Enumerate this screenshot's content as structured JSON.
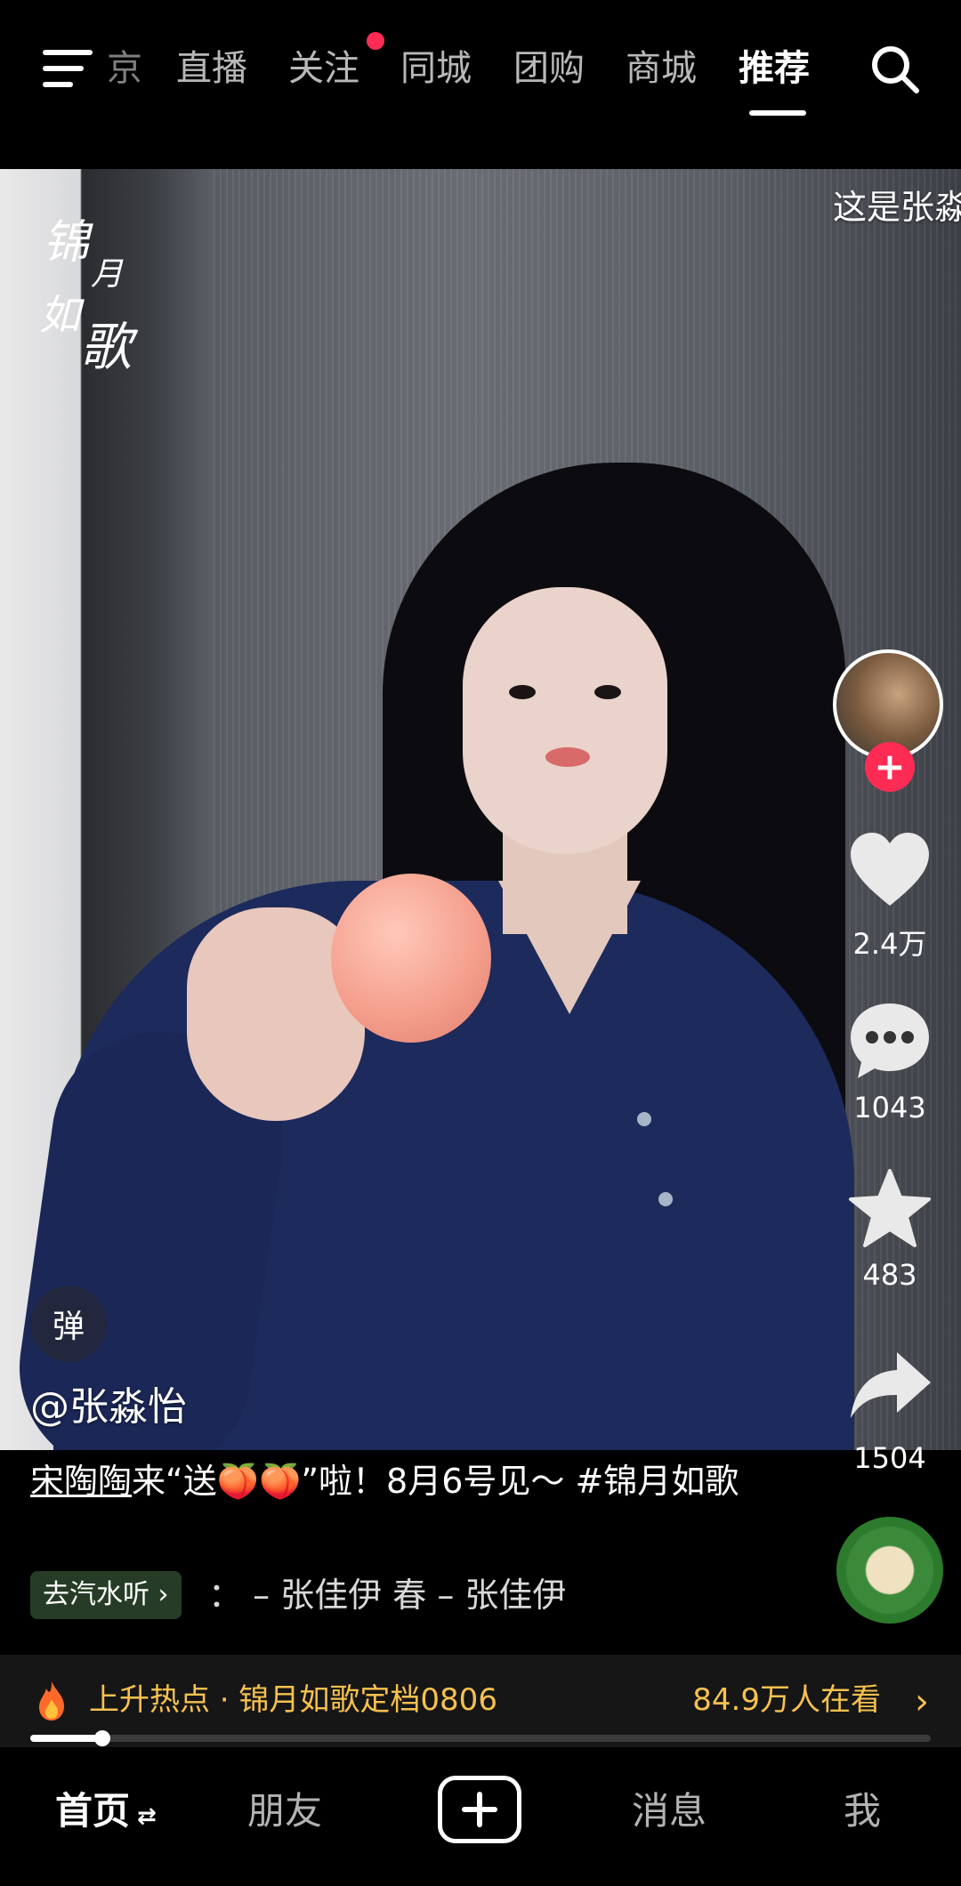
{
  "top_nav": {
    "cut_tab": "京",
    "tabs": [
      {
        "label": "直播"
      },
      {
        "label": "关注"
      },
      {
        "label": "同城"
      },
      {
        "label": "团购"
      },
      {
        "label": "商城"
      },
      {
        "label": "推荐"
      }
    ],
    "active_tab": "推荐",
    "icons": [
      "menu-icon",
      "search-icon"
    ]
  },
  "video": {
    "logo_text": "锦月如歌",
    "overlay_text": "这是张淼",
    "danmu_label": "弹",
    "author": "@张淼怡"
  },
  "rail": {
    "likes": "2.4万",
    "comments": "1043",
    "favorites": "483",
    "shares": "1504"
  },
  "caption": {
    "mention": "宋陶陶",
    "text_a": "来“送",
    "emoji": "🍑🍑",
    "text_b": "”啦！8月6号见～ #锦月如歌"
  },
  "music": {
    "button": "去汽水听",
    "track": "： – 张佳伊    春 – 张佳伊"
  },
  "hot": {
    "label": "上升热点 · 锦月如歌定档0806",
    "viewers": "84.9万人在看",
    "progress": 0.08
  },
  "bottom_nav": {
    "home": "首页",
    "friends": "朋友",
    "messages": "消息",
    "me": "我"
  },
  "colors": {
    "accent": "#fe2c55",
    "hot": "#f6c14f"
  }
}
